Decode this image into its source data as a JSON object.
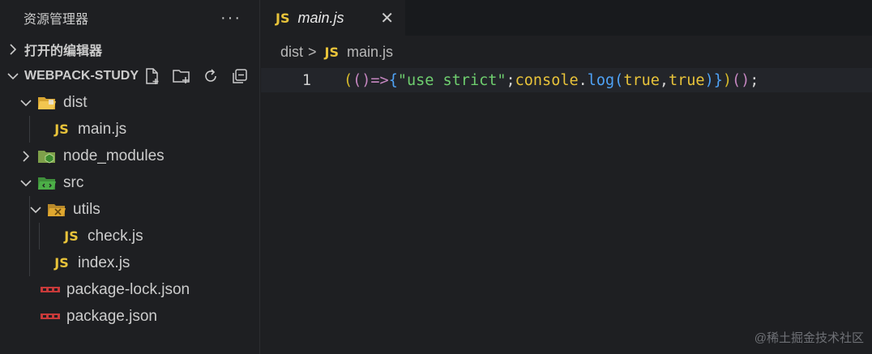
{
  "explorer": {
    "title": "资源管理器",
    "more": "···",
    "open_editors": "打开的编辑器",
    "project": "WEBPACK-STUDY",
    "tree": [
      {
        "label": "dist"
      },
      {
        "label": "main.js",
        "badge": "JS"
      },
      {
        "label": "node_modules"
      },
      {
        "label": "src"
      },
      {
        "label": "utils"
      },
      {
        "label": "check.js",
        "badge": "JS"
      },
      {
        "label": "index.js",
        "badge": "JS"
      },
      {
        "label": "package-lock.json"
      },
      {
        "label": "package.json"
      }
    ]
  },
  "editor": {
    "tab": {
      "badge": "JS",
      "label": "main.js",
      "close": "✕"
    },
    "breadcrumb": {
      "folder": "dist",
      "sep": ">",
      "badge": "JS",
      "file": "main.js"
    },
    "line_number": "1",
    "code_tokens": [
      {
        "t": "(",
        "c": "#d7ba2a"
      },
      {
        "t": "()",
        "c": "#c586c0"
      },
      {
        "t": "=>",
        "c": "#c586c0"
      },
      {
        "t": "{",
        "c": "#4fa3f7"
      },
      {
        "t": "\"use strict\"",
        "c": "#6fcf6f"
      },
      {
        "t": ";",
        "c": "#d4d4d4"
      },
      {
        "t": "console",
        "c": "#e8c33a"
      },
      {
        "t": ".",
        "c": "#d4d4d4"
      },
      {
        "t": "log",
        "c": "#4fa3f7"
      },
      {
        "t": "(",
        "c": "#4fa3f7"
      },
      {
        "t": "true",
        "c": "#e8c33a"
      },
      {
        "t": ",",
        "c": "#d4d4d4"
      },
      {
        "t": "true",
        "c": "#e8c33a"
      },
      {
        "t": ")",
        "c": "#4fa3f7"
      },
      {
        "t": "}",
        "c": "#4fa3f7"
      },
      {
        "t": ")",
        "c": "#d7ba2a"
      },
      {
        "t": "()",
        "c": "#c586c0"
      },
      {
        "t": ";",
        "c": "#d4d4d4"
      }
    ]
  },
  "watermark": "@稀土掘金技术社区",
  "colors": {
    "js_badge": "#e8c33a",
    "background": "#1e1f22"
  }
}
